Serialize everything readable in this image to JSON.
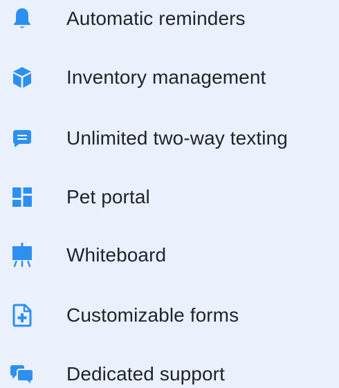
{
  "colors": {
    "background": "#eaf1fd",
    "icon": "#2d8ff0",
    "text": "#22232b"
  },
  "features": [
    {
      "icon": "bell-icon",
      "label": "Automatic reminders"
    },
    {
      "icon": "box-icon",
      "label": "Inventory management"
    },
    {
      "icon": "chat-icon",
      "label": "Unlimited two-way texting"
    },
    {
      "icon": "dashboard-icon",
      "label": "Pet portal"
    },
    {
      "icon": "whiteboard-icon",
      "label": "Whiteboard"
    },
    {
      "icon": "form-icon",
      "label": "Customizable forms"
    },
    {
      "icon": "support-chat-icon",
      "label": "Dedicated support"
    }
  ]
}
